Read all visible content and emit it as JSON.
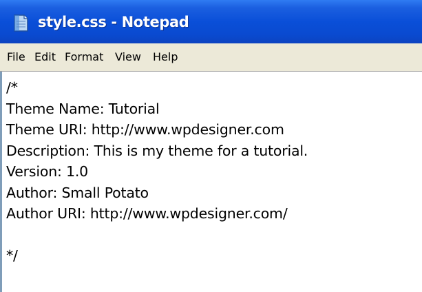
{
  "window": {
    "title": "style.css - Notepad",
    "icon": "notepad-icon"
  },
  "menu": {
    "items": [
      {
        "label": "File"
      },
      {
        "label": "Edit"
      },
      {
        "label": "Format"
      },
      {
        "label": "View"
      },
      {
        "label": "Help"
      }
    ]
  },
  "editor": {
    "content": "/*\nTheme Name: Tutorial\nTheme URI: http://www.wpdesigner.com\nDescription: This is my theme for a tutorial.\nVersion: 1.0\nAuthor: Small Potato\nAuthor URI: http://www.wpdesigner.com/\n\n*/"
  },
  "colors": {
    "titlebar": "#0a4fd8",
    "menubar": "#ece9d8",
    "editor_background": "#ffffff"
  }
}
